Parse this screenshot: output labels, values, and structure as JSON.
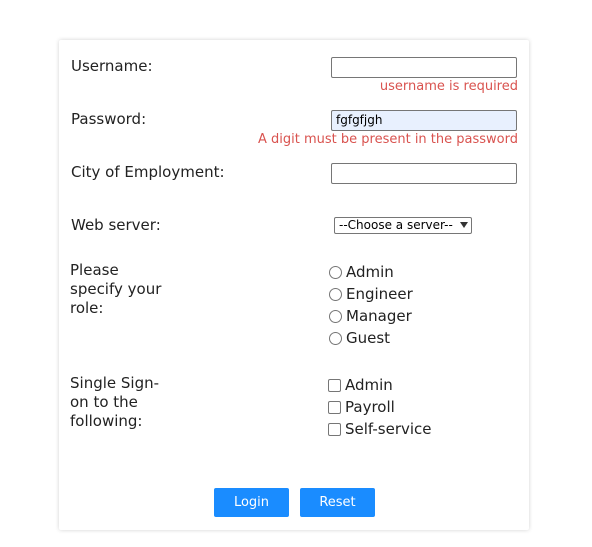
{
  "form": {
    "username": {
      "label": "Username:",
      "value": "",
      "error": "username is required"
    },
    "password": {
      "label": "Password:",
      "value": "fgfgfjgh",
      "error": "A digit must be present in the password"
    },
    "city": {
      "label": "City of Employment:",
      "value": ""
    },
    "web_server": {
      "label": "Web server:",
      "selected": "--Choose a server--"
    },
    "role": {
      "label_lines": [
        "Please",
        "specify your",
        "role:"
      ],
      "options": [
        "Admin",
        "Engineer",
        "Manager",
        "Guest"
      ]
    },
    "sso": {
      "label_lines": [
        "Single Sign-",
        "on to the",
        "following:"
      ],
      "options": [
        "Admin",
        "Payroll",
        "Self-service"
      ]
    },
    "buttons": {
      "login": "Login",
      "reset": "Reset"
    }
  },
  "colors": {
    "accent": "#1a8cff",
    "error": "#d9534f",
    "autofill": "#e8f0fe"
  }
}
